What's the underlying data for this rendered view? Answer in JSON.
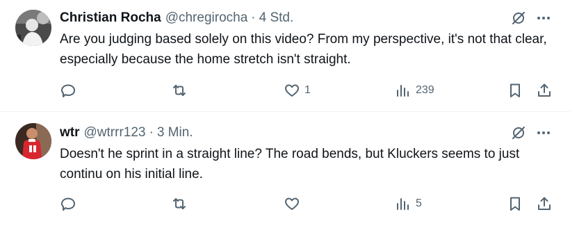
{
  "tweets": [
    {
      "author_name": "Christian Rocha",
      "handle": "@chregirocha",
      "separator": "·",
      "timestamp": "4 Std.",
      "text": "Are you judging based solely on this video? From my perspective, it's not that clear, especially because the home stretch isn't straight.",
      "likes": "1",
      "views": "239"
    },
    {
      "author_name": "wtr",
      "handle": "@wtrrr123",
      "separator": "·",
      "timestamp": "3 Min.",
      "text": "Doesn't he sprint in a straight line? The road bends, but Kluckers seems to just continu on his initial line.",
      "likes": "",
      "views": "5"
    }
  ],
  "icons": {
    "reply": "reply-icon",
    "retweet": "retweet-icon",
    "like": "like-icon",
    "views": "views-icon",
    "bookmark": "bookmark-icon",
    "share": "share-icon",
    "grok": "grok-icon",
    "more": "more-icon"
  },
  "colors": {
    "text_primary": "#0f1419",
    "text_secondary": "#536471",
    "divider": "#eff3f4"
  }
}
